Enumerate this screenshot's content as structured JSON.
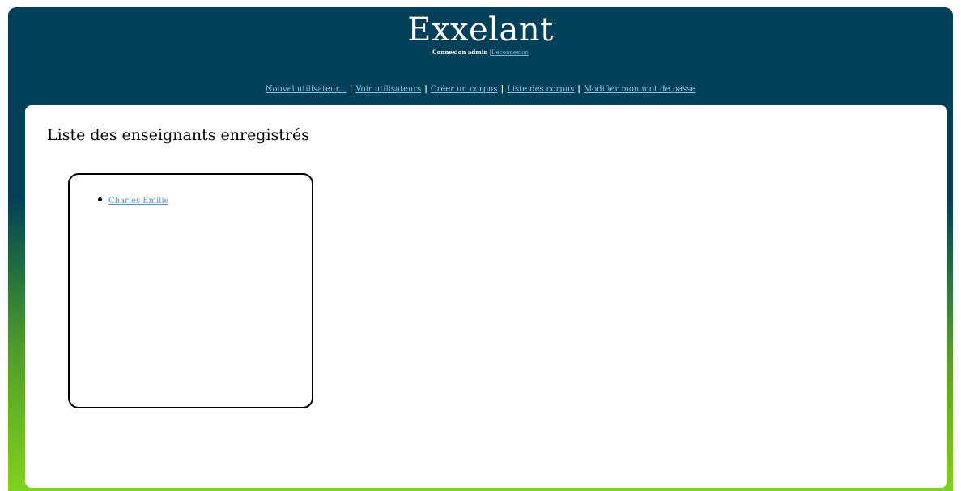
{
  "header": {
    "site_title": "Exxelant",
    "login_status": "Connexion admin",
    "login_separator": "|",
    "logout_link": "Déconnexion"
  },
  "nav": {
    "items": [
      {
        "label": "Nouvel utilisateur..."
      },
      {
        "label": "Voir utilisateurs"
      },
      {
        "label": "Créer un corpus"
      },
      {
        "label": "Liste des corpus"
      },
      {
        "label": "Modifier mon mot de passe"
      }
    ],
    "separator": "|"
  },
  "main": {
    "title": "Liste des enseignants enregistrés",
    "teachers": [
      {
        "name": "Charles Emilie"
      }
    ]
  },
  "colors": {
    "header_bg": "#02405a",
    "gradient_bottom": "#7fd21c",
    "link": "#5a8fba",
    "nav_link": "#8cc3e2"
  }
}
